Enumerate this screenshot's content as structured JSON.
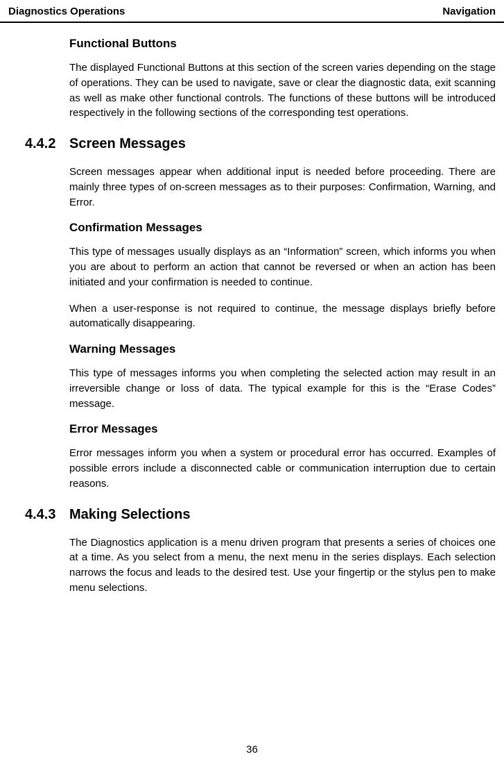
{
  "header": {
    "left": "Diagnostics Operations",
    "right": "Navigation"
  },
  "sections": {
    "functional_buttons": {
      "title": "Functional Buttons",
      "body": "The displayed Functional Buttons at this section of the screen varies depending on the stage of operations. They can be used to navigate, save or clear the diagnostic data, exit scanning as well as make other functional controls. The functions of these buttons will be introduced respectively in the following sections of the corresponding test operations."
    },
    "screen_messages": {
      "number": "4.4.2",
      "title": "Screen Messages",
      "intro": "Screen messages appear when additional input is needed before proceeding. There are mainly three types of on-screen messages as to their purposes: Confirmation, Warning, and Error.",
      "confirmation": {
        "title": "Confirmation Messages",
        "p1": "This type of messages usually displays as an “Information” screen, which informs you when you are about to perform an action that cannot be reversed or when an action has been initiated and your confirmation is needed to continue.",
        "p2": "When a user-response is not required to continue, the message displays briefly before automatically disappearing."
      },
      "warning": {
        "title": "Warning Messages",
        "body": "This type of messages informs you when completing the selected action may result in an irreversible change or loss of data. The typical example for this is the “Erase Codes” message."
      },
      "error": {
        "title": "Error Messages",
        "body": "Error messages inform you when a system or procedural error has occurred. Examples of possible errors include a disconnected cable or communication interruption due to certain reasons."
      }
    },
    "making_selections": {
      "number": "4.4.3",
      "title": "Making Selections",
      "body": "The Diagnostics application is a menu driven program that presents a series of choices one at a time. As you select from a menu, the next menu in the series displays. Each selection narrows the focus and leads to the desired test. Use your fingertip or the stylus pen to make menu selections."
    }
  },
  "page_number": "36"
}
